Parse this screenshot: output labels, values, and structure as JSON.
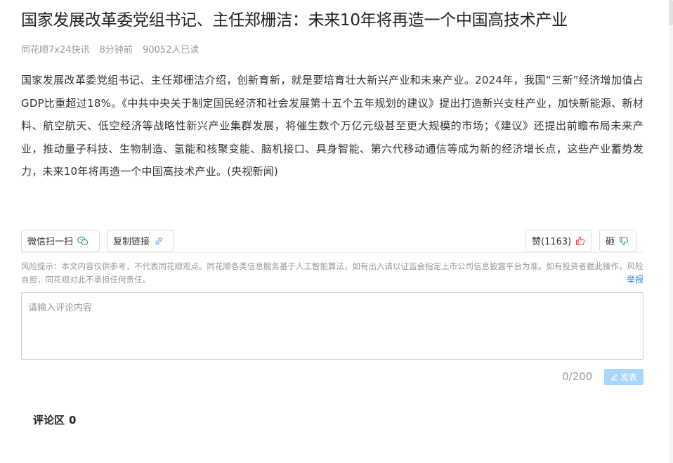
{
  "article": {
    "title": "国家发展改革委党组书记、主任郑栅洁：未来10年将再造一个中国高技术产业",
    "meta": {
      "source": "同花顺7x24快讯",
      "time": "8分钟前",
      "reads": "90052人已读"
    },
    "body": "国家发展改革委党组书记、主任郑栅洁介绍，创新育新，就是要培育壮大新兴产业和未来产业。2024年，我国“三新”经济增加值占GDP比重超过18%。《中共中央关于制定国民经济和社会发展第十五个五年规划的建议》提出打造新兴支柱产业，加快新能源、新材料、航空航天、低空经济等战略性新兴产业集群发展，将催生数个万亿元级甚至更大规模的市场；《建议》还提出前瞻布局未来产业，推动量子科技、生物制造、氢能和核聚变能、脑机接口、具身智能、第六代移动通信等成为新的经济增长点，这些产业蓄势发力，未来10年将再造一个中国高技术产业。(央视新闻)"
  },
  "actions": {
    "wechat_label": "微信扫一扫",
    "copy_label": "复制链接",
    "like_label": "赞(1163)",
    "dislike_label": "砸"
  },
  "risk_notice": "风险提示：本文内容仅供参考，不代表同花顺观点。同花顺各类信息服务基于人工智能算法，如有出入请以证监会指定上市公司信息披露平台为准。如有投资者据此操作，风险自担，同花顺对此不承担任何责任。",
  "report_label": "举报",
  "comment": {
    "placeholder": "请输入评论内容",
    "count": "0/200",
    "post_label": "发表",
    "section_title": "评论区",
    "section_count": "0"
  },
  "colors": {
    "accent": "#3a7bd5",
    "post_button": "#a9d6fb",
    "like_icon": "#e04a3a",
    "dislike_icon": "#3aa15a",
    "wechat_icon": "#3aa15a"
  },
  "icons": {
    "wechat": "wechat-icon",
    "copy": "link-icon",
    "like": "thumbs-up-icon",
    "dislike": "thumbs-down-icon",
    "post": "pencil-icon"
  }
}
